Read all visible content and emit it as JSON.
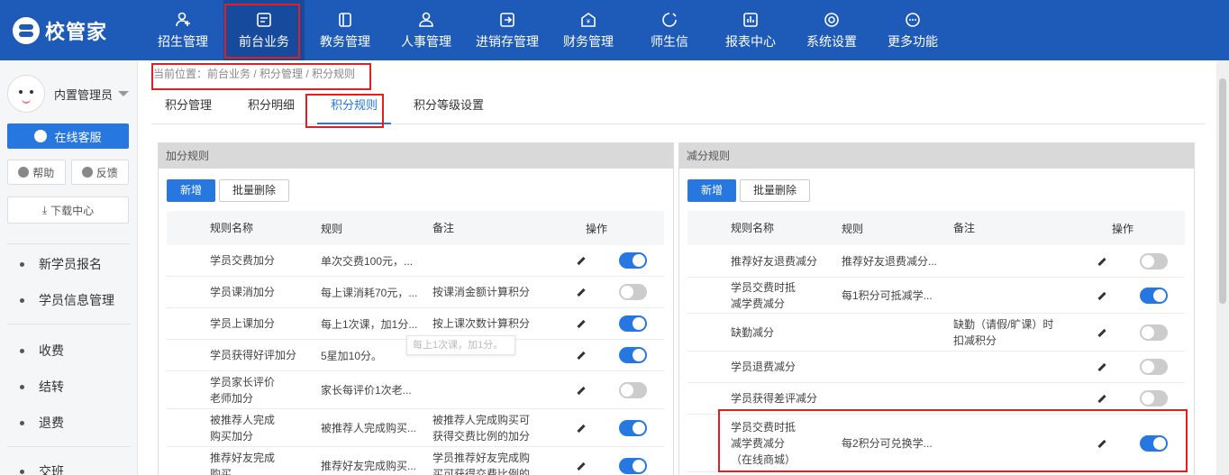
{
  "app": {
    "logo_text": "校管家"
  },
  "nav": [
    {
      "label": "招生管理",
      "icon": "user-plus-icon"
    },
    {
      "label": "前台业务",
      "icon": "desk-icon",
      "active": true
    },
    {
      "label": "教务管理",
      "icon": "book-icon"
    },
    {
      "label": "人事管理",
      "icon": "person-icon"
    },
    {
      "label": "进销存管理",
      "icon": "inventory-icon"
    },
    {
      "label": "财务管理",
      "icon": "finance-icon"
    },
    {
      "label": "师生信",
      "icon": "message-icon"
    },
    {
      "label": "报表中心",
      "icon": "report-icon"
    },
    {
      "label": "系统设置",
      "icon": "gear-icon"
    },
    {
      "label": "更多功能",
      "icon": "more-icon"
    }
  ],
  "sidebar": {
    "user_name": "内置管理员",
    "service_label": "在线客服",
    "help_label": "帮助",
    "feedback_label": "反馈",
    "download_label": "下载中心",
    "items": [
      {
        "label": "新学员报名"
      },
      {
        "label": "学员信息管理"
      },
      {
        "label": "收费"
      },
      {
        "label": "结转"
      },
      {
        "label": "退费"
      },
      {
        "label": "交班"
      }
    ]
  },
  "breadcrumb": "当前位置：前台业务 / 积分管理 / 积分规则",
  "tabs": [
    {
      "label": "积分管理"
    },
    {
      "label": "积分明细"
    },
    {
      "label": "积分规则",
      "active": true
    },
    {
      "label": "积分等级设置"
    }
  ],
  "add_panel": {
    "title": "加分规则",
    "add_label": "新增",
    "bulk_delete_label": "批量删除",
    "columns": {
      "name": "规则名称",
      "rule": "规则",
      "note": "备注",
      "action": "操作"
    },
    "rows": [
      {
        "name": "学员交费加分",
        "rule": "单次交费100元，...",
        "note": "",
        "enabled": true
      },
      {
        "name": "学员课消加分",
        "rule": "每上课消耗70元，...",
        "note": "按课消金额计算积分",
        "enabled": false
      },
      {
        "name": "学员上课加分",
        "rule": "每上1次课，加1分...",
        "note": "按上课次数计算积分",
        "enabled": true
      },
      {
        "name": "学员获得好评加分",
        "rule": "5星加10分。",
        "note": "",
        "enabled": true
      },
      {
        "name": "学员家长评价老师加分",
        "rule": "家长每评价1次老...",
        "note": "",
        "enabled": false
      },
      {
        "name": "被推荐人完成购买加分",
        "rule": "被推荐人完成购买...",
        "note": "被推荐人完成购买可获得交费比例的加分",
        "enabled": true
      },
      {
        "name": "推荐好友完成购买",
        "rule": "推荐好友完成购买...",
        "note": "学员推荐好友完成购买可获得交费比例的",
        "enabled": true
      }
    ],
    "tooltip": "每上1次课，加1分。"
  },
  "sub_panel": {
    "title": "减分规则",
    "add_label": "新增",
    "bulk_delete_label": "批量删除",
    "columns": {
      "name": "规则名称",
      "rule": "规则",
      "note": "备注",
      "action": "操作"
    },
    "rows": [
      {
        "name": "推荐好友退费减分",
        "rule": "推荐好友退费减分...",
        "note": "",
        "enabled": false
      },
      {
        "name": "学员交费时抵减学费减分",
        "rule": "每1积分可抵减学...",
        "note": "",
        "enabled": true
      },
      {
        "name": "缺勤减分",
        "rule": "",
        "note": "缺勤（请假/旷课）时扣减积分",
        "enabled": false
      },
      {
        "name": "学员退费减分",
        "rule": "",
        "note": "",
        "enabled": false
      },
      {
        "name": "学员获得差评减分",
        "rule": "",
        "note": "",
        "enabled": false
      },
      {
        "name": "学员交费时抵减学费减分（在线商城）",
        "rule": "每2积分可兑换学...",
        "note": "",
        "enabled": true
      }
    ]
  }
}
